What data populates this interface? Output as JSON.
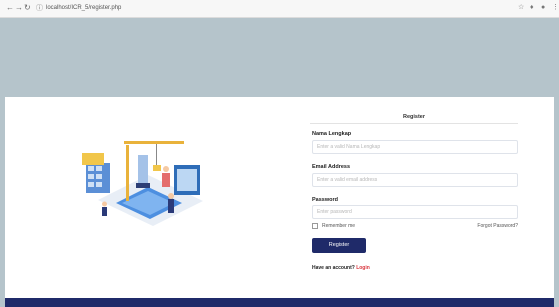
{
  "browser": {
    "url": "localhost/ICR_5/register.php"
  },
  "form": {
    "title": "Register",
    "name_label": "Nama Lengkap",
    "name_placeholder": "Enter a valid Nama Lengkap",
    "email_label": "Email Address",
    "email_placeholder": "Enter a valid email address",
    "password_label": "Password",
    "password_placeholder": "Enter password",
    "remember_label": "Remember me",
    "forgot_label": "Forgot Password?",
    "register_button": "Register",
    "have_account_text": "Have an account?",
    "login_link": "Login"
  },
  "colors": {
    "page_bg": "#b5c4cb",
    "brand": "#1f2a69",
    "link": "#d9363e"
  }
}
